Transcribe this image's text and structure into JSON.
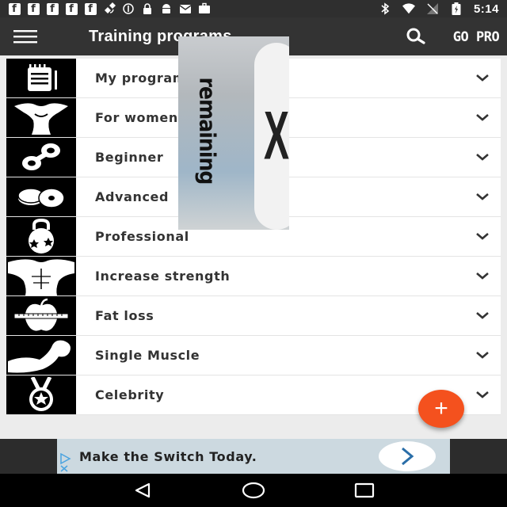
{
  "status_bar": {
    "time": "5:14",
    "fb_glyph": "f"
  },
  "toolbar": {
    "title": "Training programs",
    "go_pro_label": "GO PRO"
  },
  "programs": [
    {
      "label": "My programs",
      "icon": "notebook-icon"
    },
    {
      "label": "For women",
      "icon": "woman-body-icon"
    },
    {
      "label": "Beginner",
      "icon": "dumbbell-icon"
    },
    {
      "label": "Advanced",
      "icon": "weight-plates-icon"
    },
    {
      "label": "Professional",
      "icon": "kettlebell-icon"
    },
    {
      "label": "Increase strength",
      "icon": "torso-icon"
    },
    {
      "label": "Fat loss",
      "icon": "apple-tape-icon"
    },
    {
      "label": "Single Muscle",
      "icon": "flexed-arm-icon"
    },
    {
      "label": "Celebrity",
      "icon": "medal-icon"
    }
  ],
  "overlay": {
    "text": "remaining",
    "close_glyph": "X"
  },
  "fab": {
    "glyph": "+"
  },
  "ad": {
    "text": "Make the Switch Today."
  },
  "colors": {
    "toolbar": "#333333",
    "fab": "#f4511e",
    "ad_background": "#ccd9e0"
  }
}
